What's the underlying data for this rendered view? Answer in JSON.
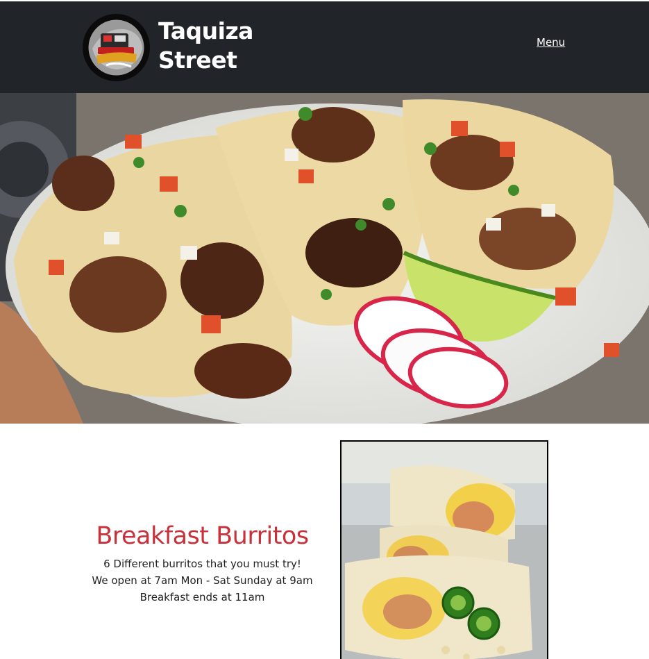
{
  "header": {
    "brand_line1": "Taquiza",
    "brand_line2": "Street",
    "logo_text": "Taquiza Street",
    "menu_label": "Menu"
  },
  "feature": {
    "title": "Breakfast Burritos",
    "lines": [
      "6 Different burritos that you must try!",
      "We open at 7am Mon - Sat Sunday at 9am",
      "Breakfast ends at 11am"
    ]
  },
  "colors": {
    "navbar": "#212529",
    "title_red": "#c8303a",
    "text": "#222222"
  }
}
